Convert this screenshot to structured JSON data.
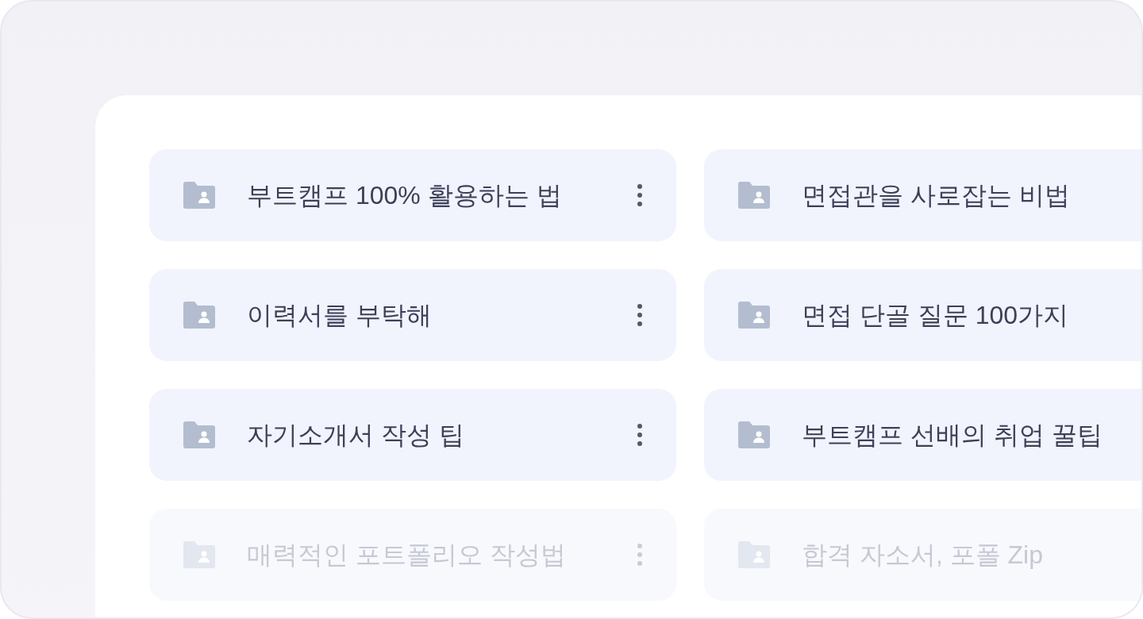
{
  "folders": [
    {
      "name": "부트캠프 100% 활용하는 법",
      "menu": true,
      "dimmed": false
    },
    {
      "name": "면접관을 사로잡는 비법",
      "dimmed": false
    },
    {
      "name": "이력서를 부탁해",
      "menu": true,
      "dimmed": false
    },
    {
      "name": "면접 단골 질문 100가지",
      "dimmed": false
    },
    {
      "name": "자기소개서 작성 팁",
      "menu": true,
      "dimmed": false
    },
    {
      "name": "부트캠프 선배의 취업 꿀팁",
      "dimmed": false
    },
    {
      "name": "매력적인 포트폴리오 작성법",
      "menu": true,
      "dimmed": true
    },
    {
      "name": "합격 자소서, 포폴 Zip",
      "dimmed": true
    }
  ]
}
